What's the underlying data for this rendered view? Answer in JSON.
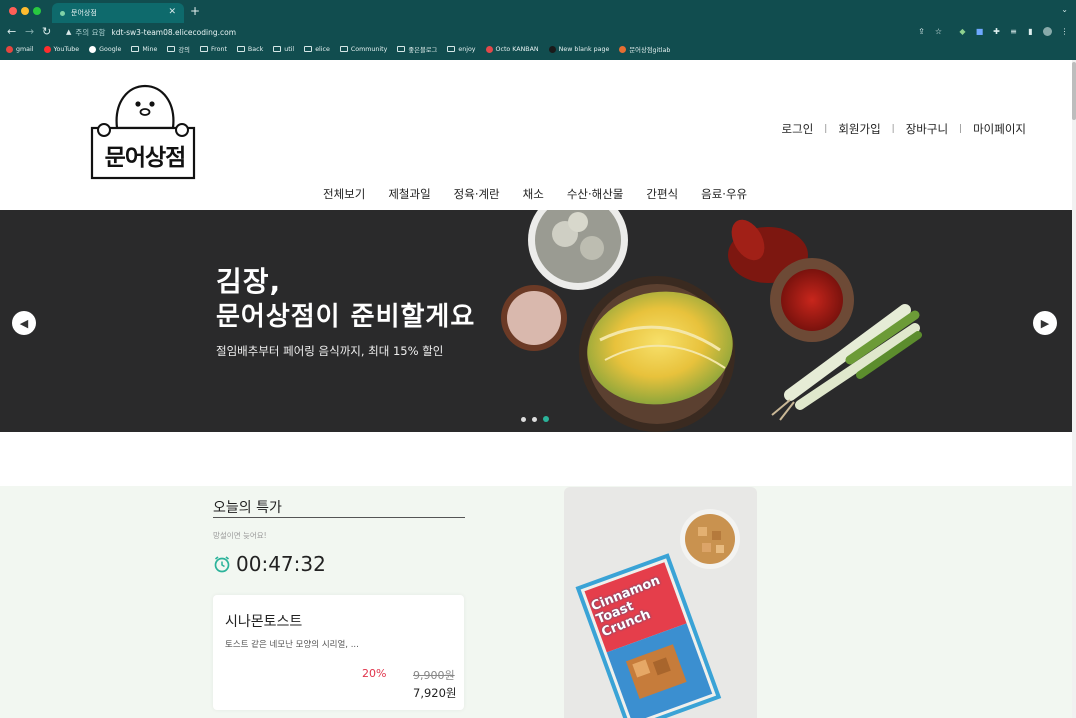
{
  "browser": {
    "tab_title": "문어상점",
    "url_warning": "주의 요함",
    "url": "kdt-sw3-team08.elicecoding.com",
    "bookmarks": [
      {
        "label": "gmail",
        "icon": "gmail-icon"
      },
      {
        "label": "YouTube",
        "icon": "youtube-icon"
      },
      {
        "label": "Google",
        "icon": "google-icon"
      },
      {
        "label": "Mine",
        "icon": "folder-icon"
      },
      {
        "label": "강의",
        "icon": "folder-icon"
      },
      {
        "label": "Front",
        "icon": "folder-icon"
      },
      {
        "label": "Back",
        "icon": "folder-icon"
      },
      {
        "label": "util",
        "icon": "folder-icon"
      },
      {
        "label": "elice",
        "icon": "folder-icon"
      },
      {
        "label": "Community",
        "icon": "folder-icon"
      },
      {
        "label": "좋은블로그",
        "icon": "folder-icon"
      },
      {
        "label": "enjoy",
        "icon": "folder-icon"
      },
      {
        "label": "Octo KANBAN",
        "icon": "octo-icon"
      },
      {
        "label": "New blank page",
        "icon": "page-icon"
      },
      {
        "label": "문어상점gitlab",
        "icon": "gitlab-icon"
      }
    ]
  },
  "header": {
    "logo_text": "문어상점",
    "user_nav": [
      "로그인",
      "회원가입",
      "장바구니",
      "마이페이지"
    ],
    "gnb": [
      "전체보기",
      "제철과일",
      "정육·계란",
      "채소",
      "수산·해산물",
      "간편식",
      "음료·우유"
    ]
  },
  "hero": {
    "title_line1": "김장,",
    "title_line2": "문어상점이 준비할게요",
    "subtitle": "절임배추부터 페어링 음식까지, 최대 15% 할인",
    "slide_count": 3,
    "active_slide": 3
  },
  "deal": {
    "title": "오늘의 특가",
    "note": "망설이면 늦어요!",
    "timer": "00:47:32",
    "product": {
      "name": "시나몬토스트",
      "description": "토스트 같은 네모난 모양의 시리얼, ...",
      "discount": "20%",
      "original_price": "9,900원",
      "price": "7,920원",
      "image_text": "Cinnamon Toast Crunch"
    }
  },
  "colors": {
    "chrome": "#114d4f",
    "accent_green": "#2bb39a",
    "discount_red": "#e0344b",
    "deal_bg": "#f2f7f1"
  }
}
